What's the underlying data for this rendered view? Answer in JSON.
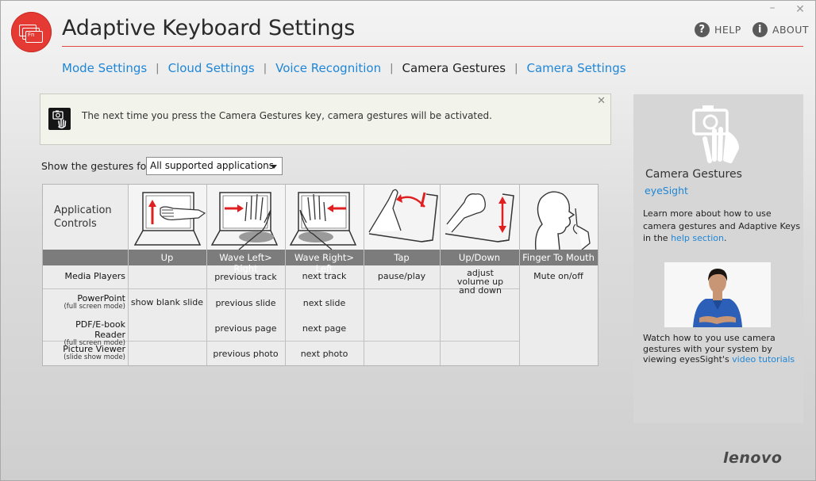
{
  "app": {
    "title": "Adaptive Keyboard Settings",
    "logo_text": "Fn"
  },
  "window": {
    "minimize_glyph": "–",
    "close_glyph": "✕"
  },
  "top_links": {
    "help": "HELP",
    "about": "ABOUT",
    "help_glyph": "?",
    "about_glyph": "i"
  },
  "nav": {
    "tabs": [
      {
        "label": "Mode Settings",
        "active": false
      },
      {
        "label": "Cloud Settings",
        "active": false
      },
      {
        "label": "Voice Recognition",
        "active": false
      },
      {
        "label": "Camera Gestures",
        "active": true
      },
      {
        "label": "Camera Settings",
        "active": false
      }
    ],
    "separator": "|"
  },
  "notice": {
    "text": "The next time you press the Camera Gestures key, camera gestures will be activated.",
    "close_glyph": "✕"
  },
  "filter": {
    "label": "Show the gestures for",
    "selected": "All supported applications"
  },
  "table": {
    "corner_label": [
      "Application",
      "Controls"
    ],
    "columns": [
      "Up",
      "Wave Left> Right",
      "Wave Right> Left",
      "Tap",
      "Up/Down",
      "Finger To Mouth"
    ],
    "rows": [
      {
        "name": "Media Players",
        "sub": "",
        "cells": [
          "",
          "previous track",
          "next track",
          "pause/play",
          "adjust volume up and down",
          "Mute on/off"
        ]
      },
      {
        "name": "PowerPoint",
        "sub": "(full screen mode)",
        "cells": [
          "show blank slide",
          "previous slide",
          "next slide",
          "",
          "",
          ""
        ]
      },
      {
        "name": "PDF/E-book Reader",
        "sub": "(full screen mode)",
        "cells": [
          "",
          "previous page",
          "next page",
          "",
          "",
          ""
        ]
      },
      {
        "name": "Picture Viewer",
        "sub": "(slide show mode)",
        "cells": [
          "",
          "previous photo",
          "next photo",
          "",
          "",
          ""
        ]
      }
    ]
  },
  "side": {
    "title": "Camera Gestures",
    "subtitle": "eyeSight",
    "learn_prefix": "Learn more about how to use camera gestures and Adaptive Keys in the ",
    "learn_link": "help section",
    "learn_suffix": ".",
    "watch_prefix": "Watch how to you use camera gestures with your system by viewing eyesSight's ",
    "watch_link": "video tutorials"
  },
  "brand": {
    "name": "lenovo"
  },
  "colors": {
    "accent": "#1f86d6",
    "logo": "#e53a33",
    "rule": "#e24a41",
    "header_bar": "#7c7c7c",
    "arrow": "#e02020"
  }
}
